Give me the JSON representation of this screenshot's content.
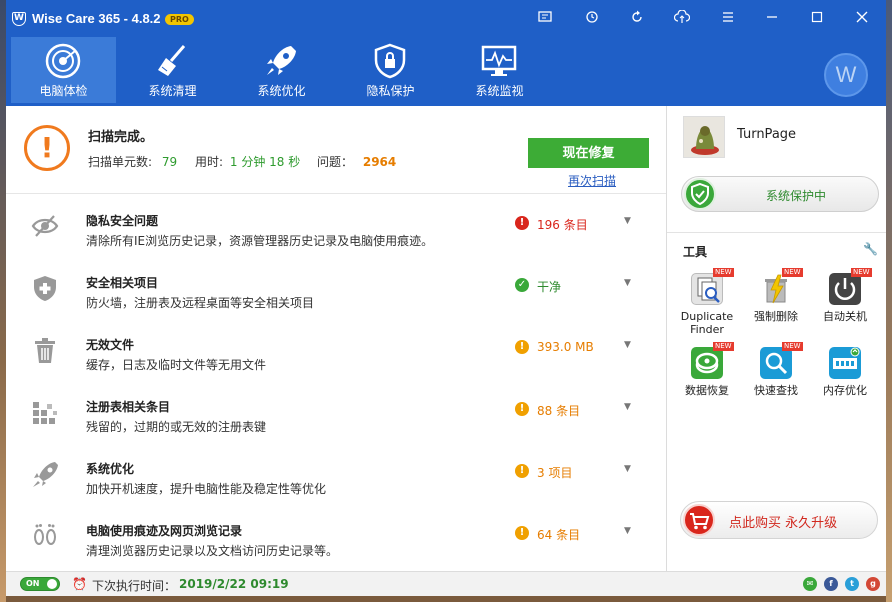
{
  "window": {
    "title": "Wise Care 365 - 4.8.2",
    "badge": "PRO",
    "avatar_letter": "W",
    "controls": [
      "feedback-icon",
      "restore-icon",
      "refresh-icon",
      "upload-icon",
      "menu-icon",
      "minimize-icon",
      "maximize-icon",
      "close-icon"
    ]
  },
  "nav": {
    "items": [
      {
        "label": "电脑体检",
        "icon": "radar-icon"
      },
      {
        "label": "系统清理",
        "icon": "broom-icon"
      },
      {
        "label": "系统优化",
        "icon": "rocket-icon"
      },
      {
        "label": "隐私保护",
        "icon": "shield-lock-icon"
      },
      {
        "label": "系统监视",
        "icon": "monitor-icon"
      }
    ]
  },
  "summary": {
    "title": "扫描完成。",
    "units_label": "扫描单元数:",
    "units_value": "79",
    "time_label": "用时:",
    "time_value": "1 分钟 18 秒",
    "issues_label": "问题：",
    "issues_value": "2964",
    "fix_button": "现在修复",
    "rescan_link": "再次扫描"
  },
  "items": [
    {
      "title": "隐私安全问题",
      "desc": "清除所有IE浏览历史记录，资源管理器历史记录及电脑使用痕迹。",
      "status": "196 条目",
      "state": "error",
      "icon": "eye-off-icon"
    },
    {
      "title": "安全相关项目",
      "desc": "防火墙，注册表及远程桌面等安全相关项目",
      "status": "干净",
      "state": "ok",
      "icon": "shield-plus-icon"
    },
    {
      "title": "无效文件",
      "desc": "缓存，日志及临时文件等无用文件",
      "status": "393.0 MB",
      "state": "warn",
      "icon": "trash-icon"
    },
    {
      "title": "注册表相关条目",
      "desc": "残留的，过期的或无效的注册表键",
      "status": "88 条目",
      "state": "warn",
      "icon": "registry-blocks-icon"
    },
    {
      "title": "系统优化",
      "desc": "加快开机速度，提升电脑性能及稳定性等优化",
      "status": "3 项目",
      "state": "warn",
      "icon": "rocket-icon"
    },
    {
      "title": "电脑使用痕迹及网页浏览记录",
      "desc": "清理浏览器历史记录以及文档访问历史记录等。",
      "status": "64 条目",
      "state": "warn",
      "icon": "footprints-icon"
    }
  ],
  "colors": {
    "header": "#1f5fc7",
    "error": "#d9261c",
    "ok": "#3aa83a",
    "warn": "#f0a000",
    "warn_text": "#e67d00"
  },
  "side": {
    "profile_name": "TurnPage",
    "protection": "系统保护中",
    "tools_title": "工具",
    "tools": [
      {
        "label": "Duplicate Finder",
        "new": "NEW",
        "icon": "duplicate-finder-icon"
      },
      {
        "label": "强制删除",
        "new": "NEW",
        "icon": "force-delete-icon"
      },
      {
        "label": "自动关机",
        "new": "NEW",
        "icon": "auto-shutdown-icon"
      },
      {
        "label": "数据恢复",
        "new": "NEW",
        "icon": "data-recovery-icon"
      },
      {
        "label": "快速查找",
        "new": "NEW",
        "icon": "quick-search-icon"
      },
      {
        "label": "内存优化",
        "new": "",
        "icon": "memory-optimizer-icon"
      }
    ],
    "buy": "点此购买 永久升级"
  },
  "footer": {
    "toggle": "ON",
    "next_label": "下次执行时间：",
    "next_value": "2019/2/22 09:19",
    "social": [
      "email-icon",
      "facebook-icon",
      "twitter-icon",
      "google-plus-icon"
    ]
  }
}
